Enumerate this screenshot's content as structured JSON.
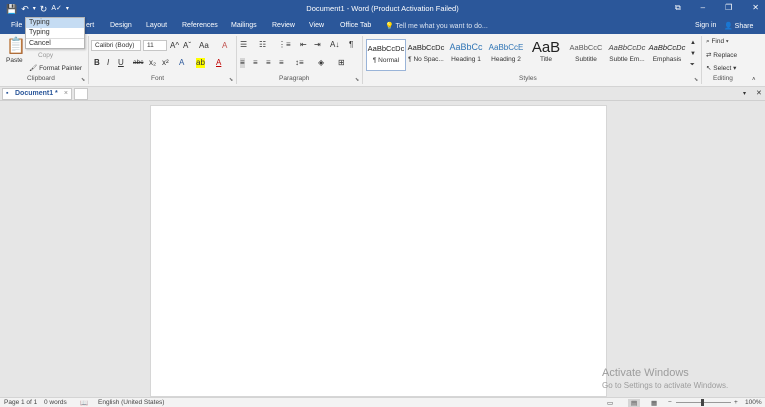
{
  "window": {
    "title": "Document1 - Word (Product Activation Failed)",
    "controls": {
      "ribbon_options": "⧉",
      "minimize": "–",
      "restore": "❐",
      "close": "✕"
    }
  },
  "qat": {
    "save": "💾",
    "undo": "↶",
    "undo_arrow": "▾",
    "redo": "↻",
    "spelling": "A✓",
    "customize": "▾"
  },
  "undo_dropdown": {
    "items": [
      "Typing",
      "Typing"
    ],
    "cancel": "Cancel"
  },
  "tabs": {
    "file": "File",
    "insert_partial": "ert",
    "design": "Design",
    "layout": "Layout",
    "references": "References",
    "mailings": "Mailings",
    "review": "Review",
    "view": "View",
    "office_tab": "Office Tab",
    "tell_me": "Tell me what you want to do...",
    "sign_in": "Sign in",
    "share": "Share"
  },
  "clipboard": {
    "label": "Clipboard",
    "paste": "Paste",
    "copy": "Copy",
    "format_painter": "Format Painter"
  },
  "font": {
    "label": "Font",
    "family": "Calibri (Body)",
    "size": "11",
    "grow": "A^",
    "shrink": "Aˇ",
    "case": "Aa",
    "clear": "A",
    "bold": "B",
    "italic": "I",
    "underline": "U",
    "strike": "abc",
    "subscript": "x₂",
    "superscript": "x²",
    "effects": "A",
    "highlight": "ab",
    "color": "A"
  },
  "paragraph": {
    "label": "Paragraph",
    "sort": "A↓",
    "marks": "¶"
  },
  "styles": {
    "label": "Styles",
    "items": [
      {
        "sample": "AaBbCcDc",
        "name": "¶ Normal"
      },
      {
        "sample": "AaBbCcDc",
        "name": "¶ No Spac..."
      },
      {
        "sample": "AaBbCc",
        "name": "Heading 1"
      },
      {
        "sample": "AaBbCcE",
        "name": "Heading 2"
      },
      {
        "sample": "AaB",
        "name": "Title"
      },
      {
        "sample": "AaBbCcC",
        "name": "Subtitle"
      },
      {
        "sample": "AaBbCcDc",
        "name": "Subtle Em..."
      },
      {
        "sample": "AaBbCcDc",
        "name": "Emphasis"
      }
    ]
  },
  "editing": {
    "label": "Editing",
    "find": "Find",
    "replace": "Replace",
    "select": "Select"
  },
  "doc_tabs": {
    "active": "Document1 *",
    "close": "×"
  },
  "watermark": {
    "line1": "Activate Windows",
    "line2": "Go to Settings to activate Windows."
  },
  "status": {
    "page": "Page 1 of 1",
    "words": "0 words",
    "language": "English (United States)",
    "zoom": "100%"
  },
  "colors": {
    "accent": "#2b579a",
    "ribbon_bg": "#f3f3f3",
    "canvas_bg": "#e6e6e6",
    "font_color": "#c00000",
    "highlight": "#ffff00"
  }
}
